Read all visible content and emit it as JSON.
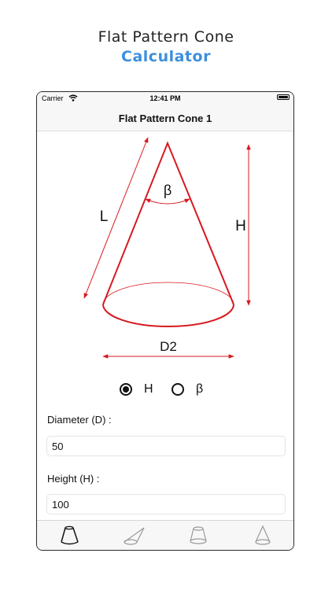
{
  "promo": {
    "title": "Flat Pattern Cone",
    "subtitle": "Calculator"
  },
  "status_bar": {
    "carrier": "Carrier",
    "time": "12:41 PM",
    "icons": [
      "wifi-icon",
      "battery-icon"
    ]
  },
  "nav": {
    "title": "Flat Pattern Cone 1"
  },
  "diagram": {
    "labels": {
      "slant": "L",
      "angle": "β",
      "height": "H",
      "diameter": "D2"
    },
    "accent_color": "#d71920"
  },
  "mode": {
    "options": [
      {
        "label": "H",
        "selected": true
      },
      {
        "label": "β",
        "selected": false
      }
    ]
  },
  "fields": {
    "diameter": {
      "label": "Diameter (D) :",
      "value": "50"
    },
    "height": {
      "label": "Height (H) :",
      "value": "100"
    }
  },
  "tabs": [
    {
      "icon": "truncated-cone-tab-icon",
      "selected": true
    },
    {
      "icon": "oblique-cone-tab-icon",
      "selected": false
    },
    {
      "icon": "frustum-tab-icon",
      "selected": false
    },
    {
      "icon": "cone-tab-icon",
      "selected": false
    }
  ]
}
